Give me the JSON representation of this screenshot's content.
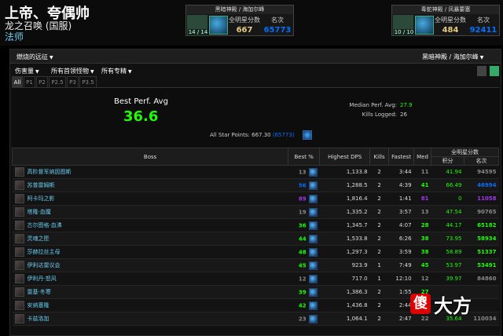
{
  "header": {
    "char_name": "上帝、夸偶帅",
    "realm": "龙之召唤 (国服)",
    "spec": "法师"
  },
  "rank_boxes": [
    {
      "zone": "黑暗神殿 / 海加尔峰",
      "kills": "14 / 14",
      "points_label": "全明星分数",
      "points": "667",
      "rank_label": "名次",
      "rank": "65773"
    },
    {
      "zone": "毒蛇神殿 / 风暴要塞",
      "kills": "10 / 10",
      "points_label": "全明星分数",
      "points": "484",
      "rank_label": "名次",
      "rank": "92411"
    }
  ],
  "topbar": {
    "left_dropdown": "燃烧的远征",
    "right_dropdown": "黑暗神殿 / 海加尔峰"
  },
  "filters": [
    {
      "label": "伤害量"
    },
    {
      "label": "所有首领怪物"
    },
    {
      "label": "所有专精"
    }
  ],
  "tabs": [
    "All",
    "P1",
    "P2",
    "P2.5",
    "P3",
    "P3.5"
  ],
  "summary": {
    "best_label": "Best Perf. Avg",
    "best_value": "36.6",
    "median_label": "Median Perf. Avg:",
    "median_value": "27.9",
    "kills_label": "Kills Logged:",
    "kills_value": "26",
    "asp_label": "All Star Points:",
    "asp_value": "667.30",
    "asp_rank": "(65773)"
  },
  "table": {
    "headers": {
      "boss": "Boss",
      "best": "Best %",
      "dps": "Highest DPS",
      "kills": "Kills",
      "fastest": "Fastest",
      "med": "Med",
      "allstar": "全明星分数",
      "points": "积分",
      "rank": "名次"
    },
    "rows": [
      {
        "boss": "高阶督军纳因图斯",
        "best": "13",
        "dps": "1,133.8",
        "kills": "2",
        "fastest": "3:44",
        "med": "11",
        "points": "41.94",
        "rank": "94595",
        "best_color": "#888888",
        "med_color": "#888888",
        "rank_color": "#888888"
      },
      {
        "boss": "苏普雷姆斯",
        "best": "56",
        "dps": "1,288.5",
        "kills": "2",
        "fastest": "4:39",
        "med": "41",
        "points": "66.49",
        "rank": "46994",
        "best_color": "#0070ff",
        "med_color": "#1eff00",
        "rank_color": "#0070ff"
      },
      {
        "boss": "阿卡玛之影",
        "best": "89",
        "dps": "1,816.4",
        "kills": "2",
        "fastest": "1:41",
        "med": "81",
        "points": "0",
        "rank": "11058",
        "best_color": "#a335ee",
        "med_color": "#a335ee",
        "rank_color": "#a335ee"
      },
      {
        "boss": "塔隆·血魔",
        "best": "19",
        "dps": "1,335.2",
        "kills": "2",
        "fastest": "3:57",
        "med": "13",
        "points": "47.54",
        "rank": "90765",
        "best_color": "#888888",
        "med_color": "#888888",
        "rank_color": "#888888"
      },
      {
        "boss": "古尔图格·血沸",
        "best": "36",
        "dps": "1,345.7",
        "kills": "2",
        "fastest": "4:07",
        "med": "28",
        "points": "44.17",
        "rank": "65182",
        "best_color": "#1eff00",
        "med_color": "#1eff00",
        "rank_color": "#1eff00"
      },
      {
        "boss": "灵魂之匣",
        "best": "44",
        "dps": "1,533.8",
        "kills": "2",
        "fastest": "6:26",
        "med": "38",
        "points": "73.95",
        "rank": "58934",
        "best_color": "#1eff00",
        "med_color": "#1eff00",
        "rank_color": "#1eff00"
      },
      {
        "boss": "莎赫拉丝主母",
        "best": "48",
        "dps": "1,297.3",
        "kills": "2",
        "fastest": "3:59",
        "med": "38",
        "points": "58.89",
        "rank": "51337",
        "best_color": "#1eff00",
        "med_color": "#1eff00",
        "rank_color": "#1eff00"
      },
      {
        "boss": "伊利达雷议会",
        "best": "45",
        "dps": "923.9",
        "kills": "1",
        "fastest": "7:49",
        "med": "45",
        "points": "53.97",
        "rank": "53491",
        "best_color": "#1eff00",
        "med_color": "#1eff00",
        "rank_color": "#1eff00"
      },
      {
        "boss": "伊利丹·怒风",
        "best": "12",
        "dps": "717.0",
        "kills": "1",
        "fastest": "12:10",
        "med": "12",
        "points": "39.97",
        "rank": "84860",
        "best_color": "#888888",
        "med_color": "#888888",
        "rank_color": "#888888"
      },
      {
        "boss": "雷基·冬寒",
        "best": "39",
        "dps": "1,386.3",
        "kills": "2",
        "fastest": "1:55",
        "med": "27",
        "points": "",
        "rank": "",
        "best_color": "#1eff00",
        "med_color": "#1eff00",
        "rank_color": "#1eff00"
      },
      {
        "boss": "安纳塞隆",
        "best": "42",
        "dps": "1,436.8",
        "kills": "2",
        "fastest": "2:44",
        "med": "29",
        "points": "",
        "rank": "",
        "best_color": "#1eff00",
        "med_color": "#1eff00",
        "rank_color": "#1eff00"
      },
      {
        "boss": "卡兹洛加",
        "best": "23",
        "dps": "1,064.1",
        "kills": "2",
        "fastest": "2:47",
        "med": "22",
        "points": "35.64",
        "rank": "110034",
        "best_color": "#888888",
        "med_color": "#888888",
        "rank_color": "#888888"
      }
    ]
  },
  "watermark": {
    "char": "傻",
    "text": "大方"
  }
}
